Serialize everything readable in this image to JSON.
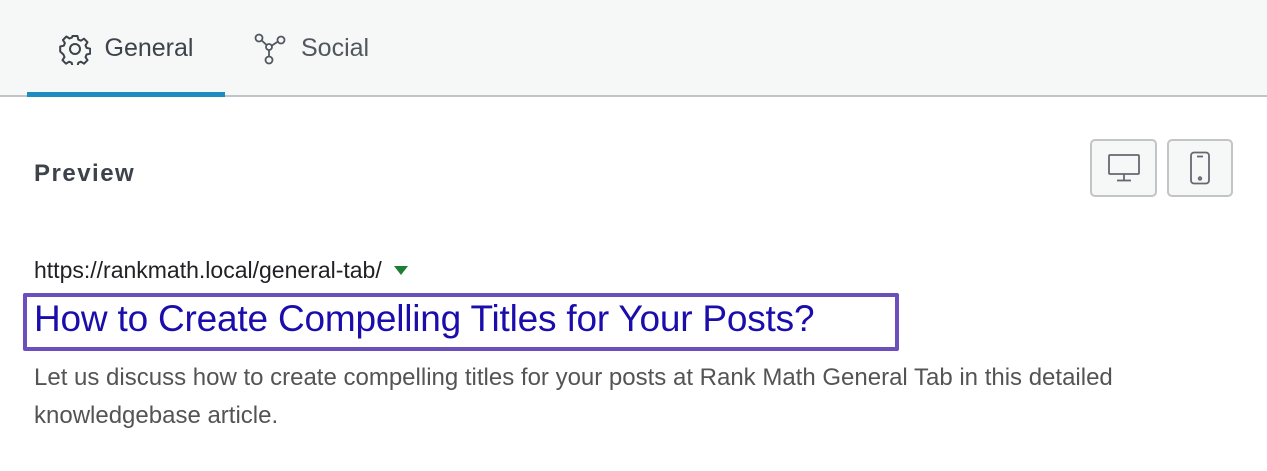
{
  "tabs": [
    {
      "label": "General",
      "icon": "gear-icon",
      "active": true
    },
    {
      "label": "Social",
      "icon": "share-nodes-icon",
      "active": false
    }
  ],
  "preview": {
    "heading": "Preview",
    "device_buttons": [
      {
        "icon": "desktop-icon"
      },
      {
        "icon": "mobile-icon"
      }
    ]
  },
  "serp": {
    "url": "https://rankmath.local/general-tab/",
    "title": "How to Create Compelling Titles for Your Posts?",
    "description": "Let us discuss how to create compelling titles for your posts at Rank Math General Tab in this detailed knowledgebase article."
  },
  "colors": {
    "active_tab_underline": "#1e8cbe",
    "serp_title": "#1a0dab",
    "highlight_box": "#6b4fbb",
    "url_caret": "#1e7e34"
  }
}
